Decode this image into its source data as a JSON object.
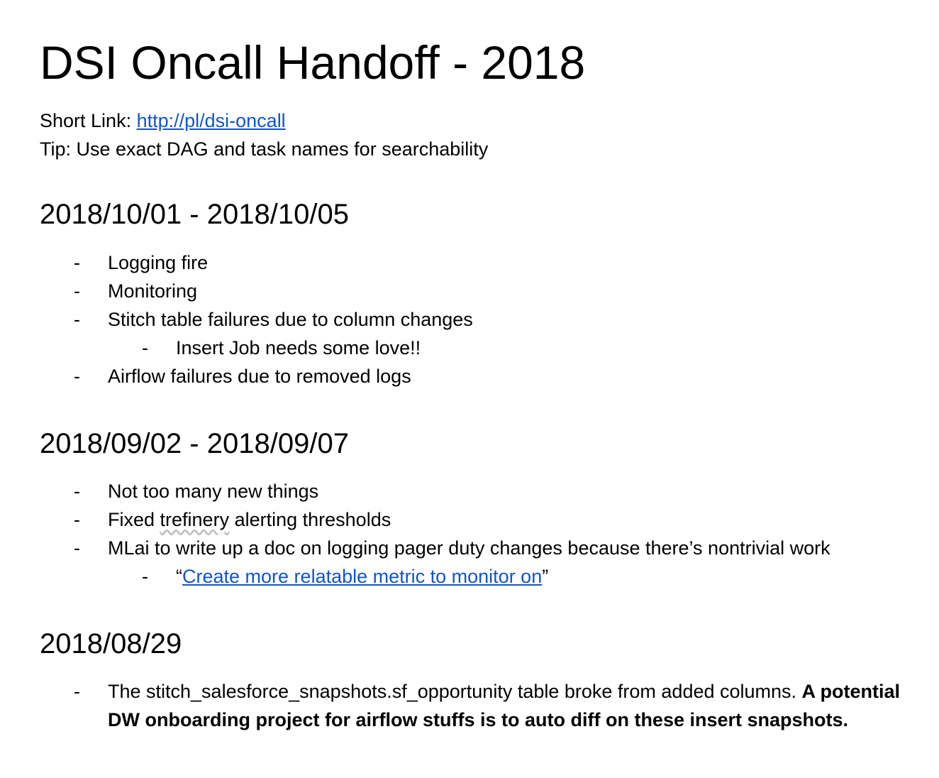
{
  "title": "DSI Oncall Handoff - 2018",
  "short_link": {
    "label": "Short Link: ",
    "url_text": "http://pl/dsi-oncall"
  },
  "tip": "Tip: Use exact DAG and task names for searchability",
  "bullet_char": "-",
  "sections": [
    {
      "heading": "2018/10/01 - 2018/10/05",
      "items": [
        {
          "text": "Logging fire"
        },
        {
          "text": "Monitoring"
        },
        {
          "text": "Stitch table failures due to column changes"
        },
        {
          "text": "Insert Job needs some love!!",
          "nested": true
        },
        {
          "text": "Airflow failures due to removed logs"
        }
      ]
    },
    {
      "heading": "2018/09/02 - 2018/09/07",
      "items": [
        {
          "text": "Not too many new things"
        },
        {
          "pre": "Fixed ",
          "flagged_word": "trefinery",
          "post": " alerting thresholds"
        },
        {
          "text": "MLai to write up a doc on logging pager duty changes because there’s nontrivial work"
        },
        {
          "open_quote": "“",
          "link_text": "Create more relatable metric to monitor on",
          "close_quote": "”",
          "nested": true
        }
      ]
    },
    {
      "heading": "2018/08/29",
      "items": [
        {
          "text": "The stitch_salesforce_snapshots.sf_opportunity table broke from added columns. ",
          "bold_text": "A potential DW onboarding project for airflow stuffs is to auto diff on these insert snapshots."
        }
      ]
    }
  ]
}
